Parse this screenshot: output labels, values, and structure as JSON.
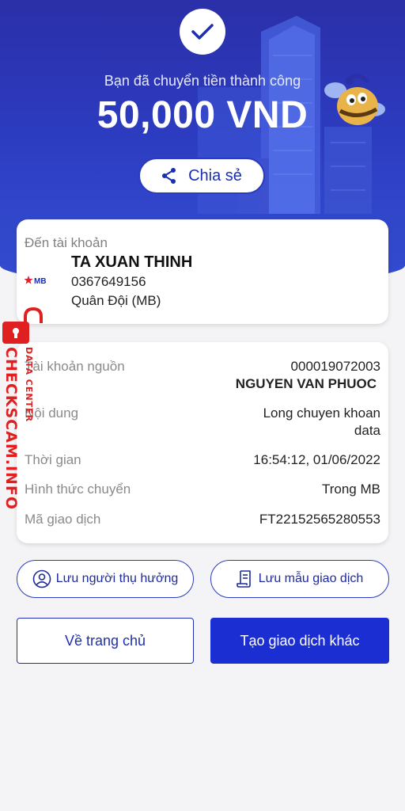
{
  "header": {
    "subtitle": "Bạn đã chuyển tiền thành công",
    "amount": "50,000 VND",
    "share_label": "Chia sẻ",
    "icons": [
      "check-icon",
      "share-icon"
    ]
  },
  "recipient": {
    "label": "Đến tài khoản",
    "name": "TA XUAN THINH",
    "account": "0367649156",
    "bank": "Quân Đội (MB)",
    "bank_logo_text": "MB"
  },
  "details": {
    "source_label": "Tài khoản nguồn",
    "source_account": "000019072003",
    "source_name": "NGUYEN VAN PHUOC",
    "content_label": "Nội dung",
    "content_line1": "Long chuyen khoan",
    "content_line2": "data",
    "time_label": "Thời gian",
    "time_value": "16:54:12, 01/06/2022",
    "method_label": "Hình thức chuyển",
    "method_value": "Trong MB",
    "txn_label": "Mã giao dịch",
    "txn_value": "FT22152565280553"
  },
  "actions": {
    "save_payee": "Lưu người thụ hưởng",
    "save_template": "Lưu mẫu giao dịch",
    "home": "Về trang chủ",
    "new_txn": "Tạo giao dịch khác"
  },
  "watermark": {
    "main": "CHECKSCAM.INFO",
    "sub": "DATA CENTER"
  },
  "colors": {
    "hero": "#2c3bbf",
    "primary_button": "#1b2ed1",
    "watermark": "#e02020"
  }
}
